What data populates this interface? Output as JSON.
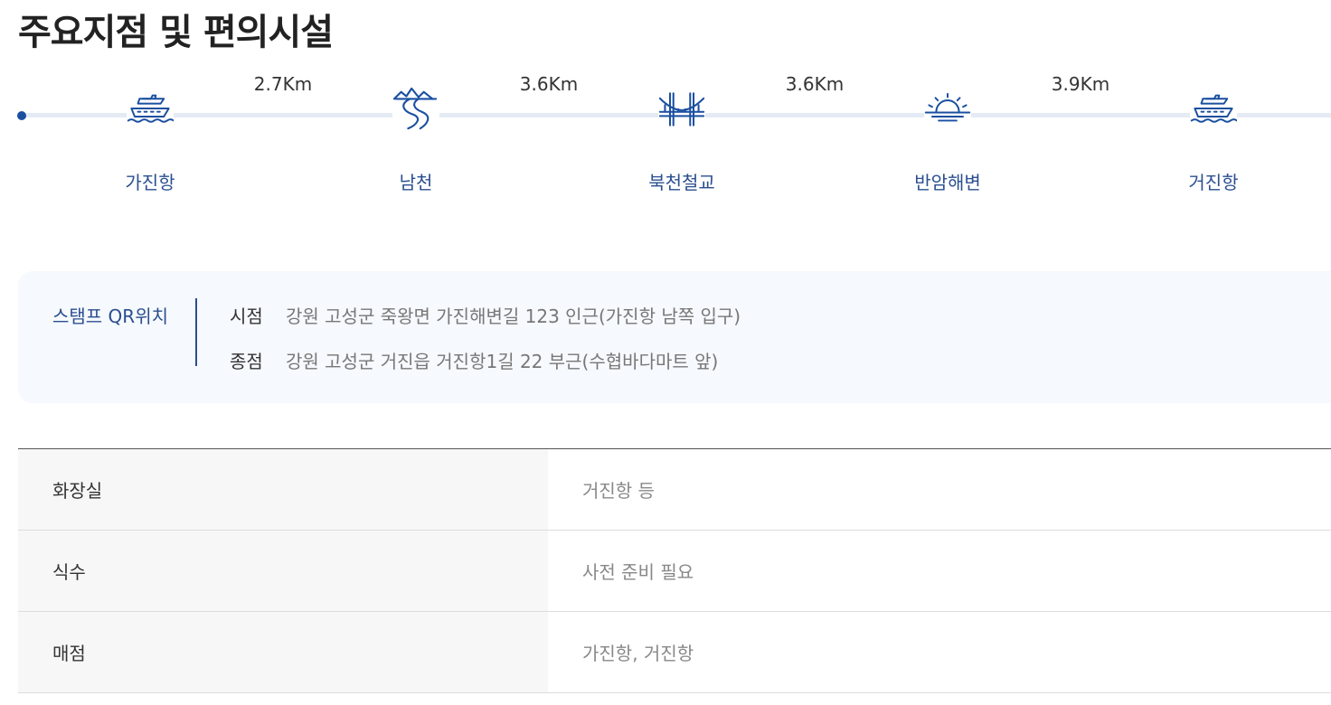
{
  "title": "주요지점 및 편의시설",
  "route": {
    "points": [
      {
        "label": "가진항",
        "icon": "ship-icon"
      },
      {
        "label": "남천",
        "icon": "river-icon"
      },
      {
        "label": "북천철교",
        "icon": "bridge-icon"
      },
      {
        "label": "반암해변",
        "icon": "sunrise-icon"
      },
      {
        "label": "거진항",
        "icon": "ship-icon"
      }
    ],
    "distances": [
      "2.7Km",
      "3.6Km",
      "3.6Km",
      "3.9Km"
    ],
    "accent_color": "#1a4fa0"
  },
  "stamp": {
    "title": "스탬프 QR위치",
    "rows": [
      {
        "key": "시점",
        "value": "강원 고성군 죽왕면 가진해변길 123 인근(가진항 남쪽 입구)"
      },
      {
        "key": "종점",
        "value": "강원 고성군 거진읍 거진항1길 22 부근(수협바다마트 앞)"
      }
    ]
  },
  "facilities": [
    {
      "key": "화장실",
      "value": "거진항 등"
    },
    {
      "key": "식수",
      "value": "사전 준비 필요"
    },
    {
      "key": "매점",
      "value": "가진항, 거진항"
    }
  ]
}
